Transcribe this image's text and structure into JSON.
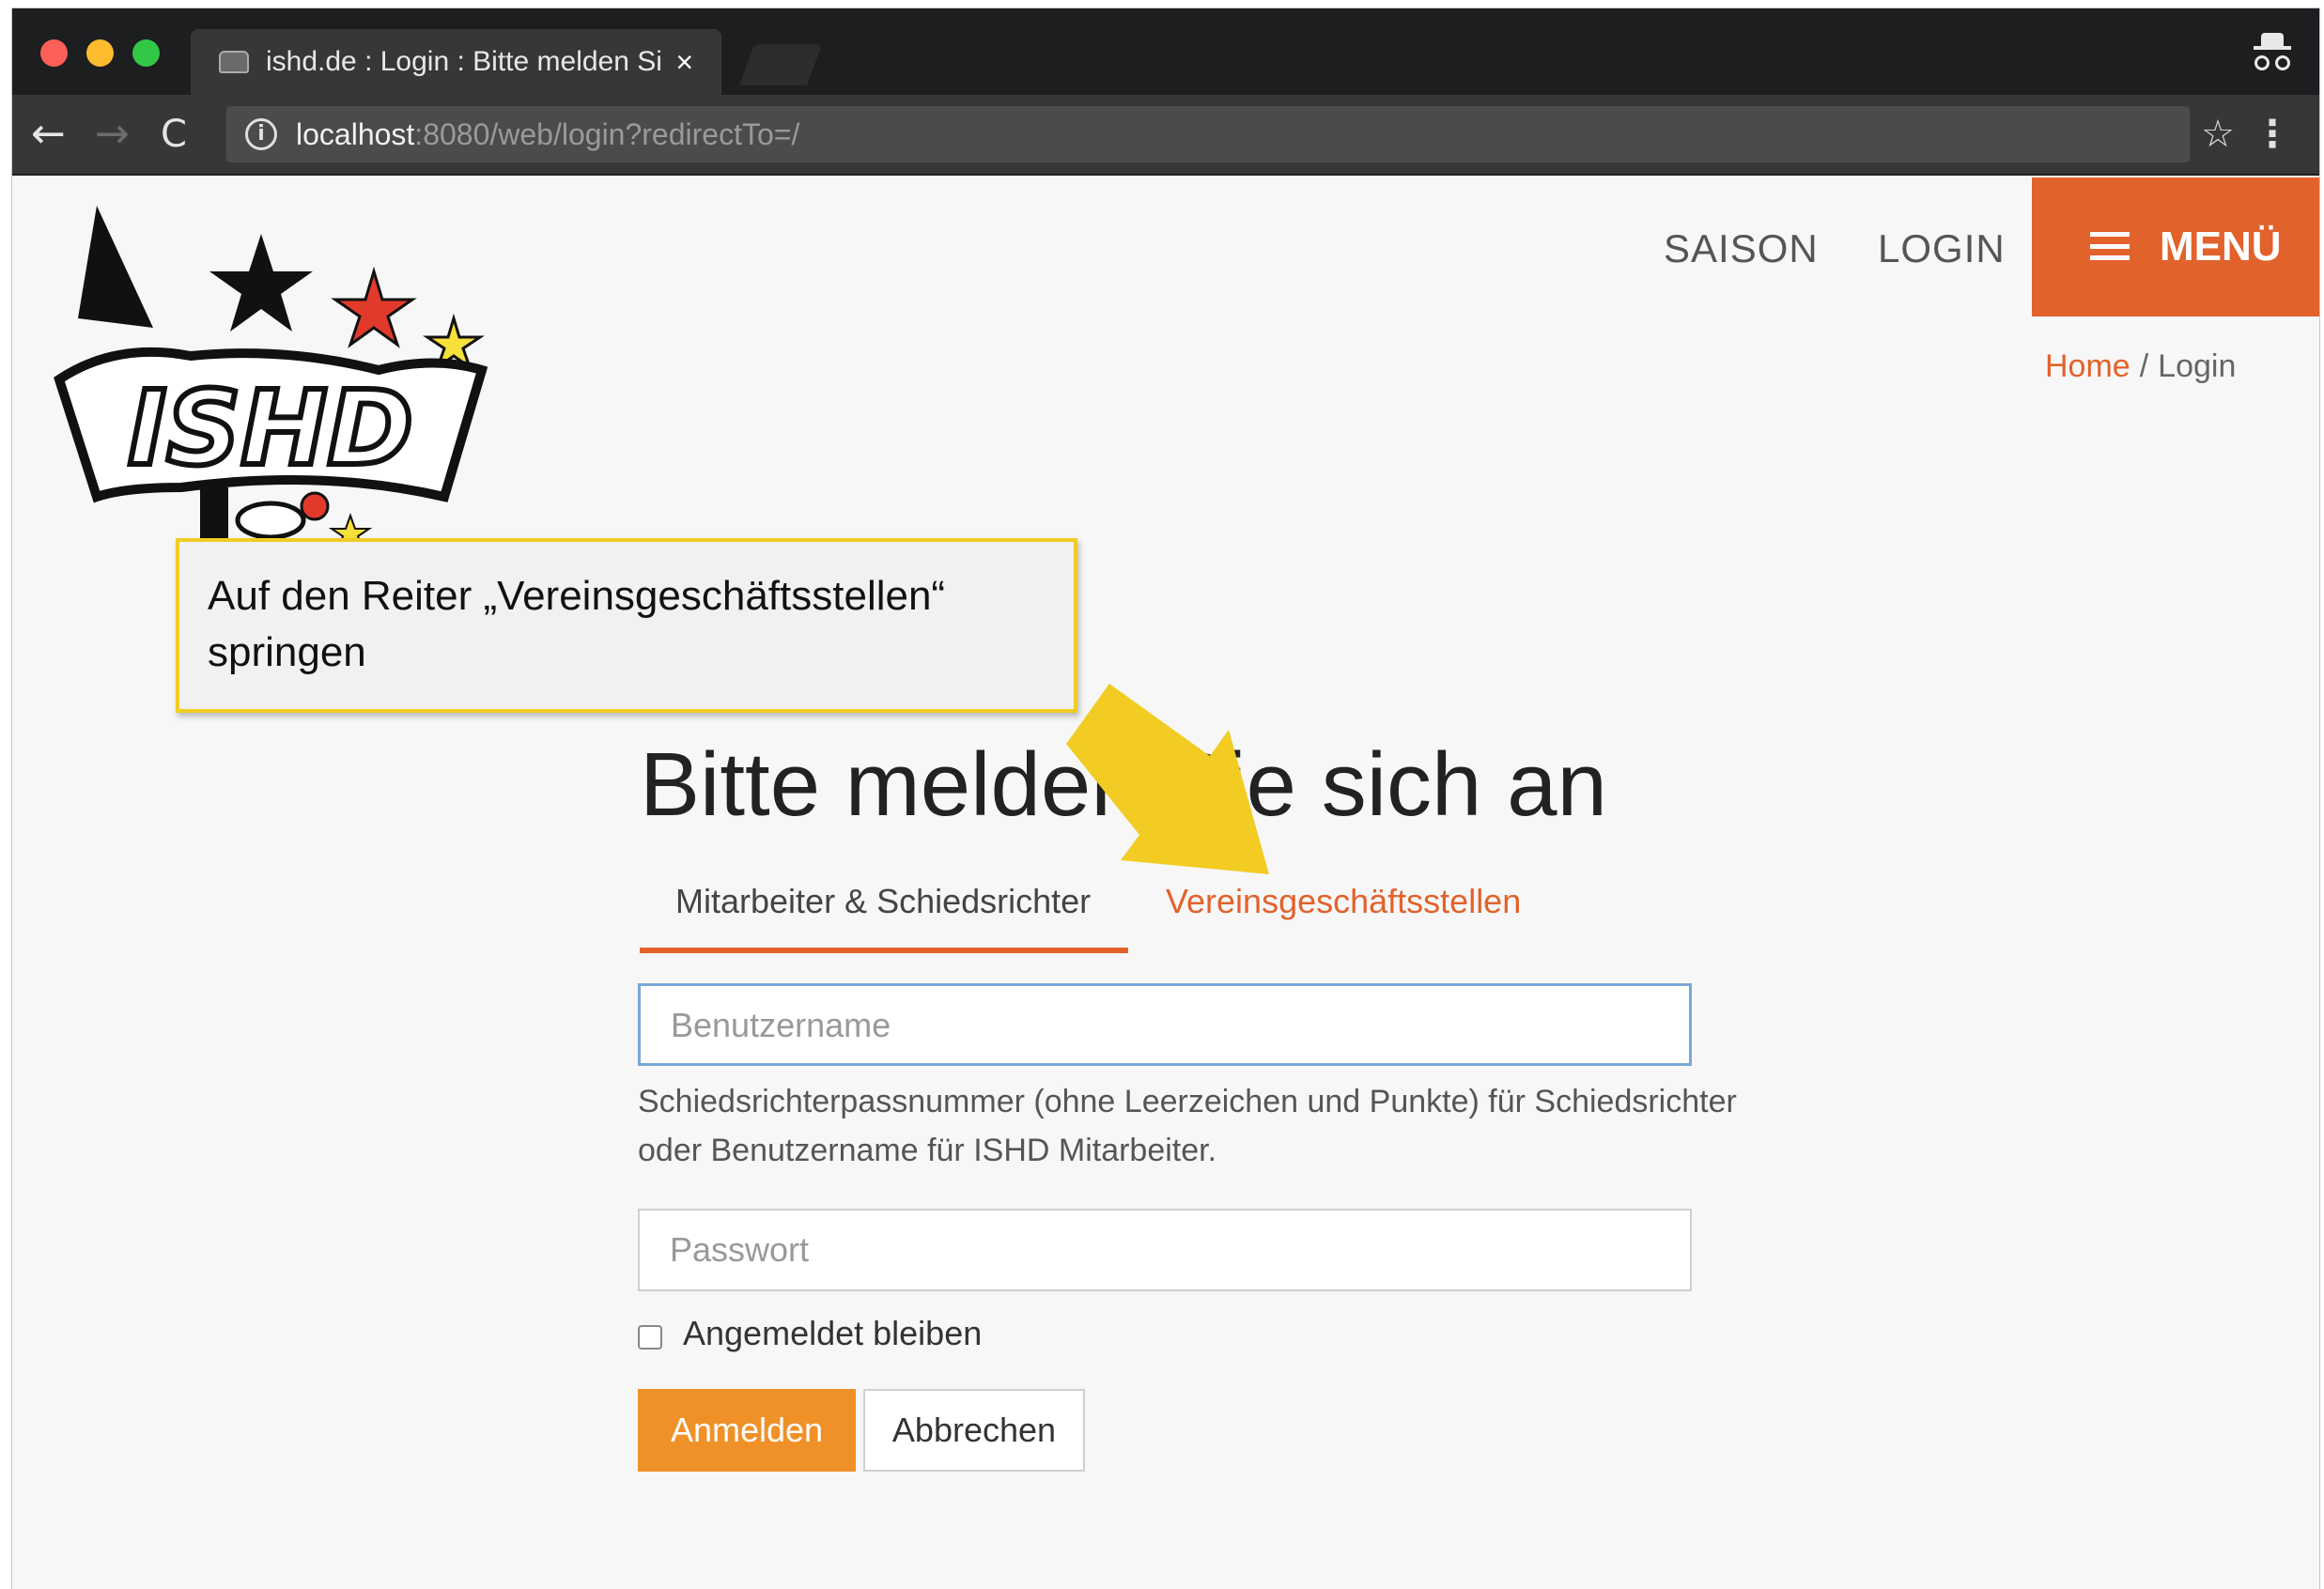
{
  "browser": {
    "tab_title": "ishd.de : Login : Bitte melden Sie sich an",
    "tab_close": "×",
    "url_host": "localhost",
    "url_path": ":8080/web/login?redirectTo=/",
    "back_icon": "←",
    "forward_icon": "→",
    "reload_icon": "C",
    "info_icon": "i",
    "star_icon": "☆",
    "menu_icon": "⋮"
  },
  "site": {
    "logo_text": "ISHD",
    "nav": {
      "saison": "SAISON",
      "login": "LOGIN",
      "menu": "MENÜ"
    },
    "breadcrumb": {
      "home": "Home",
      "separator": "/",
      "current": "Login"
    }
  },
  "callout": {
    "text": "Auf den Reiter „Vereinsgeschäftsstellen“ springen",
    "border_color": "#f0cc25",
    "arrow_color": "#f2cc22"
  },
  "login": {
    "heading": "Bitte melden Sie sich an",
    "tabs": [
      {
        "label": "Mitarbeiter & Schiedsrichter",
        "active": true
      },
      {
        "label": "Vereinsgeschäftsstellen",
        "active": false
      }
    ],
    "username_placeholder": "Benutzername",
    "username_hint": "Schiedsrichterpassnummer (ohne Leerzeichen und Punkte) für Schiedsrichter oder Benutzername für ISHD Mitarbeiter.",
    "password_placeholder": "Passwort",
    "remember_label": "Angemeldet bleiben",
    "submit_label": "Anmelden",
    "cancel_label": "Abbrechen"
  },
  "colors": {
    "accent": "#e2622b",
    "submit": "#ef9128"
  }
}
